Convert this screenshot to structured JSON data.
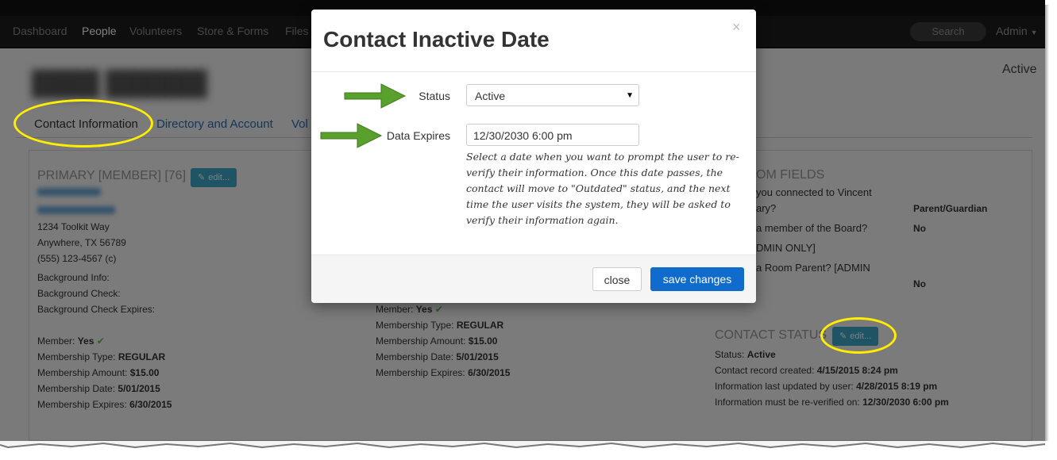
{
  "navbar": {
    "items": [
      "Dashboard",
      "People",
      "Volunteers",
      "Store & Forms",
      "Files"
    ],
    "active": "People",
    "search_placeholder": "Search",
    "admin_label": "Admin"
  },
  "page": {
    "status": "Active",
    "tabs": [
      "Contact Information",
      "Directory and Account",
      "Vol"
    ]
  },
  "primary": {
    "title": "PRIMARY [MEMBER] [76]",
    "edit_label": "edit...",
    "address": [
      "1234 Toolkit Way",
      "Anywhere, TX 56789",
      "(555) 123-4567 (c)"
    ],
    "background": [
      "Background Info:",
      "Background Check:",
      "Background Check Expires:"
    ],
    "member_label": "Member:",
    "member_value": "Yes",
    "membership_type_label": "Membership Type:",
    "membership_type_value": "REGULAR",
    "membership_amount_label": "Membership Amount:",
    "membership_amount_value": "$15.00",
    "membership_date_label": "Membership Date:",
    "membership_date_value": "5/01/2015",
    "membership_expires_label": "Membership Expires:",
    "membership_expires_value": "6/30/2015"
  },
  "secondary": {
    "member_label": "Member:",
    "member_value": "Yes",
    "membership_type_label": "Membership Type:",
    "membership_type_value": "REGULAR",
    "membership_amount_label": "Membership Amount:",
    "membership_amount_value": "$15.00",
    "membership_date_label": "Membership Date:",
    "membership_date_value": "5/01/2015",
    "membership_expires_label": "Membership Expires:",
    "membership_expires_value": "6/30/2015"
  },
  "custom_fields": {
    "title": "OM FIELDS",
    "q1_line1": "you connected to Vincent",
    "q1_line2": "ary?",
    "q1_value": "Parent/Guardian",
    "q2_line1": "a member of the Board?",
    "q2_value": "No",
    "q2_line2": "DMIN ONLY]",
    "q3_line1": "a Room Parent? [ADMIN",
    "q3_value": "No"
  },
  "contact_status": {
    "title": "CONTACT STATUS",
    "edit_label": "edit...",
    "status_label": "Status:",
    "status_value": "Active",
    "created_label": "Contact record created:",
    "created_value": "4/15/2015 8:24 pm",
    "updated_label": "Information last updated by user:",
    "updated_value": "4/28/2015 8:19 pm",
    "reverify_label": "Information must be re-verified on:",
    "reverify_value": "12/30/2030 6:00 pm"
  },
  "modal": {
    "title": "Contact Inactive Date",
    "close_icon": "×",
    "status_label": "Status",
    "status_value": "Active",
    "expires_label": "Data Expires",
    "expires_value": "12/30/2030 6:00 pm",
    "help_text": "Select a date when you want to prompt the user to re-verify their information. Once this date passes, the contact will move to \"Outdated\" status, and the next time the user visits the system, they will be asked to verify their information again.",
    "close_button": "close",
    "save_button": "save changes"
  },
  "colors": {
    "highlight": "#ffee00",
    "arrow": "#5aa02c",
    "primary_button": "#0f6ccc",
    "edit_button": "#3fa9c9"
  }
}
